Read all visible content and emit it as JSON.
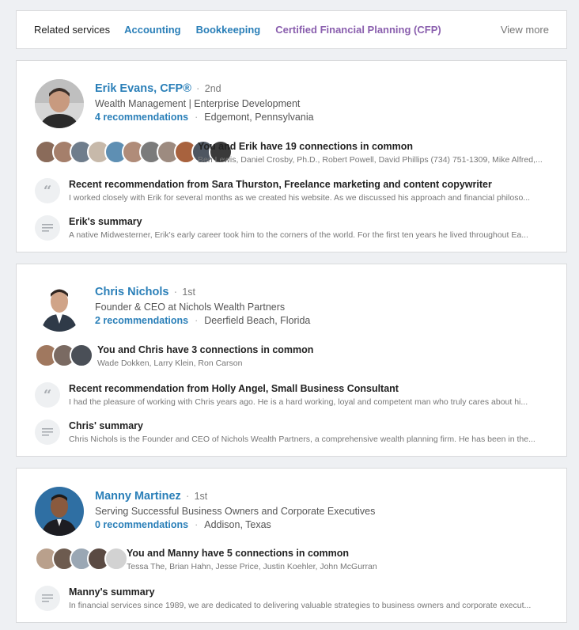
{
  "related": {
    "title": "Related services",
    "links": [
      "Accounting",
      "Bookkeeping",
      "Certified Financial Planning (CFP)"
    ],
    "view_more": "View more"
  },
  "people": [
    {
      "name": "Erik Evans, CFP®",
      "degree": "2nd",
      "headline": "Wealth Management | Enterprise Development",
      "recommendations": "4 recommendations",
      "location": "Edgemont, Pennsylvania",
      "connections_title": "You and Erik have 19 connections in common",
      "connections_names": "Ben Lewis, Daniel Crosby, Ph.D., Robert Powell, David Phillips (734) 751-1309, Mike Alfred,...",
      "rec_title": "Recent recommendation from Sara Thurston, Freelance marketing and content copywriter",
      "rec_text": "I worked closely with Erik for several months as we created his website. As we discussed his approach and financial philoso...",
      "summary_title": "Erik's summary",
      "summary_text": "A native Midwesterner, Erik's early career took him to the corners of the world. For the first ten years he lived throughout Ea..."
    },
    {
      "name": "Chris Nichols",
      "degree": "1st",
      "headline": "Founder & CEO at Nichols Wealth Partners",
      "recommendations": "2 recommendations",
      "location": "Deerfield Beach, Florida",
      "connections_title": "You and Chris have 3 connections in common",
      "connections_names": "Wade Dokken, Larry Klein, Ron Carson",
      "rec_title": "Recent recommendation from Holly Angel, Small Business Consultant",
      "rec_text": "I had the pleasure of working with Chris years ago. He is a hard working, loyal and competent man who truly cares about hi...",
      "summary_title": "Chris' summary",
      "summary_text": "Chris Nichols is the Founder and CEO of Nichols Wealth Partners, a comprehensive wealth planning firm. He has been in the..."
    },
    {
      "name": "Manny Martinez",
      "degree": "1st",
      "headline": "Serving Successful Business Owners and Corporate Executives",
      "recommendations": "0 recommendations",
      "location": "Addison, Texas",
      "connections_title": "You and Manny have 5 connections in common",
      "connections_names": "Tessa The, Brian Hahn, Jesse Price, Justin Koehler, John McGurran",
      "summary_title": "Manny's summary",
      "summary_text": "In financial services since 1989, we are dedicated to delivering valuable strategies to business owners and corporate execut..."
    }
  ],
  "colors": {
    "link": "#2a7fb8",
    "visited_link": "#8a5fae",
    "page_bg": "#eef0f3"
  },
  "icons": {
    "recommendation": "quote-icon",
    "summary": "summary-lines-icon"
  }
}
